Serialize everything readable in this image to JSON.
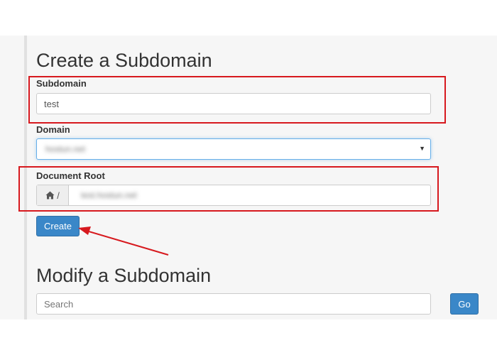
{
  "create_section": {
    "heading": "Create a Subdomain",
    "subdomain_label": "Subdomain",
    "subdomain_value": "test",
    "domain_label": "Domain",
    "domain_value": "hostun.net",
    "document_root_label": "Document Root",
    "document_root_prefix": "/",
    "document_root_value": "test.hostun.net",
    "create_button": "Create"
  },
  "modify_section": {
    "heading": "Modify a Subdomain",
    "search_placeholder": "Search",
    "go_button": "Go"
  },
  "annotation_color": "#d7191e",
  "accent_color": "#3a87c8"
}
